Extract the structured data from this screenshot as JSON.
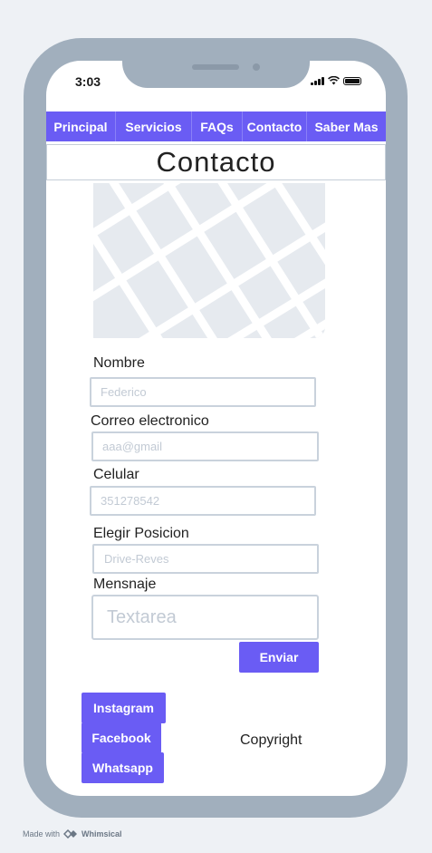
{
  "status_bar": {
    "time": "3:03"
  },
  "nav": {
    "items": [
      {
        "label": "Principal"
      },
      {
        "label": "Servicios"
      },
      {
        "label": "FAQs"
      },
      {
        "label": "Contacto"
      },
      {
        "label": "Saber Mas"
      }
    ]
  },
  "page": {
    "title": "Contacto"
  },
  "form": {
    "name_label": "Nombre",
    "name_value": "Federico",
    "email_label": "Correo electronico",
    "email_value": "aaa@gmail",
    "phone_label": "Celular",
    "phone_value": "351278542",
    "position_label": "Elegir Posicion",
    "position_value": "Drive-Reves",
    "message_label": "Mensnaje",
    "message_placeholder": "Textarea",
    "submit_label": "Enviar"
  },
  "social": {
    "instagram": "Instagram",
    "facebook": "Facebook",
    "whatsapp": "Whatsapp"
  },
  "footer": {
    "copyright": "Copyright"
  },
  "watermark": {
    "prefix": "Made with",
    "brand": "Whimsical"
  },
  "colors": {
    "accent": "#6a5cf4",
    "frame": "#a1afbd",
    "field_border": "#c9d2dc",
    "map": "#e6eaef"
  }
}
